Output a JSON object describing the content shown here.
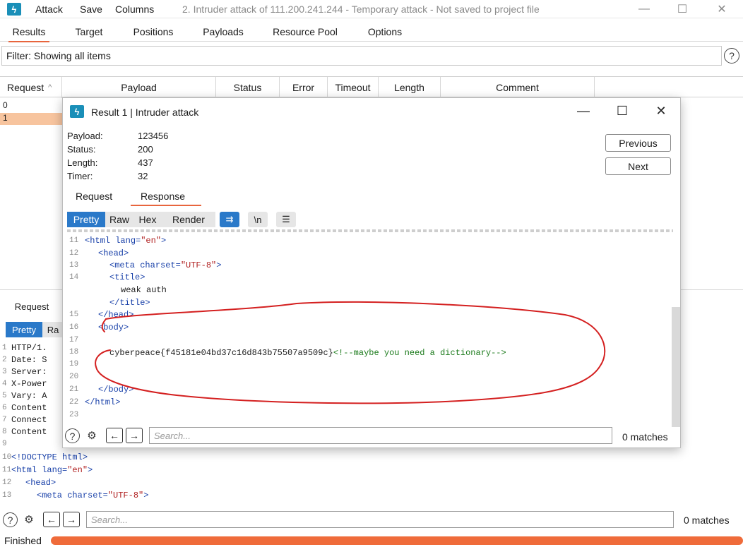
{
  "app": {
    "menu": [
      "Attack",
      "Save",
      "Columns"
    ],
    "window_title": "2. Intruder attack of 111.200.241.244 - Temporary attack - Not saved to project file",
    "controls": {
      "minimize": "—",
      "maximize": "☐",
      "close": "✕"
    }
  },
  "main_tabs": [
    "Results",
    "Target",
    "Positions",
    "Payloads",
    "Resource Pool",
    "Options"
  ],
  "filter": {
    "text": "Filter: Showing all items",
    "help": "?"
  },
  "results_table": {
    "columns": [
      "Request",
      "Payload",
      "Status",
      "Error",
      "Timeout",
      "Length",
      "Comment"
    ],
    "sort_indicator": "^",
    "rows": [
      "0",
      "1"
    ],
    "selected_row": "1"
  },
  "lower_panel": {
    "tab": "Request",
    "view_buttons": [
      "Pretty",
      "Ra"
    ],
    "lines": [
      {
        "n": "1",
        "text": "HTTP/1."
      },
      {
        "n": "2",
        "text": "Date: S"
      },
      {
        "n": "3",
        "text": "Server:"
      },
      {
        "n": "4",
        "text": "X-Power"
      },
      {
        "n": "5",
        "text": "Vary: A"
      },
      {
        "n": "6",
        "text": "Content"
      },
      {
        "n": "7",
        "text": "Connect"
      },
      {
        "n": "8",
        "text": "Content"
      },
      {
        "n": "9",
        "text": ""
      },
      {
        "n": "10",
        "text": ""
      },
      {
        "n": "11",
        "text": ""
      },
      {
        "n": "12",
        "text": ""
      },
      {
        "n": "13",
        "text": ""
      }
    ],
    "code": {
      "l10": "<!DOCTYPE html>",
      "l11_tag": "<html",
      "l11_attr": " lang=",
      "l11_str": "\"en\"",
      "l11_close": ">",
      "l12": "<head>",
      "l13_tag": "<meta",
      "l13_attr": " charset=",
      "l13_str": "\"UTF-8\"",
      "l13_close": ">"
    },
    "search_placeholder": "Search...",
    "matches": "0 matches"
  },
  "status": {
    "text": "Finished",
    "progress": 1.0
  },
  "dialog": {
    "title": "Result 1 | Intruder attack",
    "fields": [
      {
        "label": "Payload:",
        "value": "123456"
      },
      {
        "label": "Status:",
        "value": "200"
      },
      {
        "label": "Length:",
        "value": "437"
      },
      {
        "label": "Timer:",
        "value": "32"
      }
    ],
    "buttons": {
      "previous": "Previous",
      "next": "Next"
    },
    "tabs": [
      "Request",
      "Response"
    ],
    "active_tab": "Response",
    "view_buttons": [
      "Pretty",
      "Raw",
      "Hex",
      "Render"
    ],
    "icon_labels": {
      "wrap": "⇉",
      "newline": "\\n",
      "menu": "☰"
    },
    "code": {
      "l11_tag": "<html",
      "l11_attr": " lang=",
      "l11_str": "\"en\"",
      "l11_close": ">",
      "l12": "<head>",
      "l13_tag": "<meta",
      "l13_attr": " charset=",
      "l13_str": "\"UTF-8\"",
      "l13_close": ">",
      "l14": "<title>",
      "l14b": "weak auth",
      "l14c": "</title>",
      "l15": "</head>",
      "l16": "<body>",
      "l18_text": "cyberpeace{f45181e04bd37c16d843b75507a9509c}",
      "l18_cmt": "<!--maybe you need a dictionary-->",
      "l21": "</body>",
      "l22": "</html>"
    },
    "line_numbers": [
      "11",
      "12",
      "13",
      "14",
      "15",
      "16",
      "17",
      "18",
      "19",
      "20",
      "21",
      "22",
      "23"
    ],
    "search_placeholder": "Search...",
    "matches": "0 matches"
  },
  "colors": {
    "accent": "#e8653d",
    "selection": "#f7c49e",
    "pretty_active": "#2a79c9",
    "annotation": "#d42020"
  }
}
